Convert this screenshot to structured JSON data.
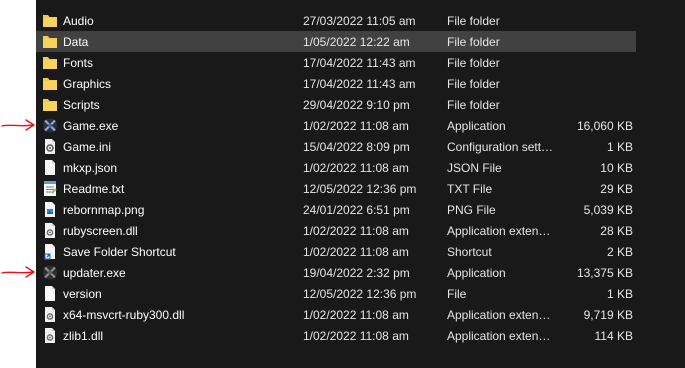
{
  "files": [
    {
      "name": "Audio",
      "date": "27/03/2022 11:05 am",
      "type": "File folder",
      "size": "",
      "icon": "folder-icon"
    },
    {
      "name": "Data",
      "date": "1/05/2022 12:22 am",
      "type": "File folder",
      "size": "",
      "icon": "folder-icon",
      "selected": true
    },
    {
      "name": "Fonts",
      "date": "17/04/2022 11:43 am",
      "type": "File folder",
      "size": "",
      "icon": "folder-icon"
    },
    {
      "name": "Graphics",
      "date": "17/04/2022 11:43 am",
      "type": "File folder",
      "size": "",
      "icon": "folder-icon"
    },
    {
      "name": "Scripts",
      "date": "29/04/2022 9:10 pm",
      "type": "File folder",
      "size": "",
      "icon": "folder-icon"
    },
    {
      "name": "Game.exe",
      "date": "1/02/2022 11:08 am",
      "type": "Application",
      "size": "16,060 KB",
      "icon": "game-exe-icon"
    },
    {
      "name": "Game.ini",
      "date": "15/04/2022 8:09 pm",
      "type": "Configuration sett…",
      "size": "1 KB",
      "icon": "config-file-icon"
    },
    {
      "name": "mkxp.json",
      "date": "1/02/2022 11:08 am",
      "type": "JSON File",
      "size": "10 KB",
      "icon": "generic-file-icon"
    },
    {
      "name": "Readme.txt",
      "date": "12/05/2022 12:36 pm",
      "type": "TXT File",
      "size": "29 KB",
      "icon": "notepad-icon"
    },
    {
      "name": "rebornmap.png",
      "date": "24/01/2022 6:51 pm",
      "type": "PNG File",
      "size": "5,039 KB",
      "icon": "image-file-icon"
    },
    {
      "name": "rubyscreen.dll",
      "date": "1/02/2022 11:08 am",
      "type": "Application exten…",
      "size": "28 KB",
      "icon": "dll-file-icon"
    },
    {
      "name": "Save Folder Shortcut",
      "date": "1/02/2022 11:08 am",
      "type": "Shortcut",
      "size": "2 KB",
      "icon": "shortcut-icon"
    },
    {
      "name": "updater.exe",
      "date": "19/04/2022 2:32 pm",
      "type": "Application",
      "size": "13,375 KB",
      "icon": "updater-exe-icon"
    },
    {
      "name": "version",
      "date": "12/05/2022 12:36 pm",
      "type": "File",
      "size": "1 KB",
      "icon": "blank-file-icon"
    },
    {
      "name": "x64-msvcrt-ruby300.dll",
      "date": "1/02/2022 11:08 am",
      "type": "Application exten…",
      "size": "9,719 KB",
      "icon": "dll-file-icon"
    },
    {
      "name": "zlib1.dll",
      "date": "1/02/2022 11:08 am",
      "type": "Application exten…",
      "size": "114 KB",
      "icon": "dll-file-icon"
    }
  ],
  "annotations": [
    {
      "points_to": "Game.exe",
      "color": "#e8121b",
      "icon": "red-arrow-icon"
    },
    {
      "points_to": "updater.exe",
      "color": "#e8121b",
      "icon": "red-arrow-icon"
    }
  ],
  "colors": {
    "background": "#191919",
    "selected_row": "#414141",
    "folder": "#f2c94c",
    "arrow": "#e8121b"
  }
}
